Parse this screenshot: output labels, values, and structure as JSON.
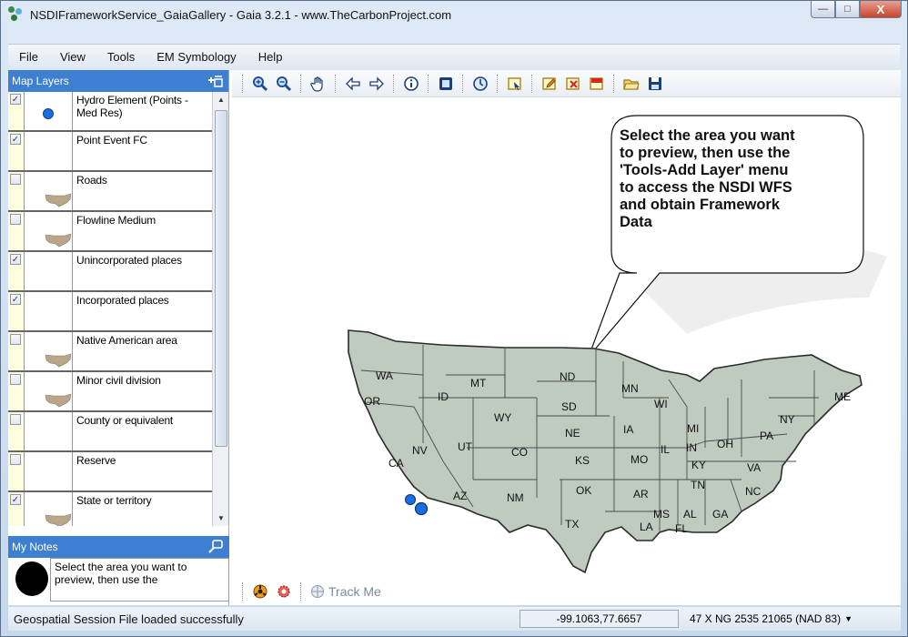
{
  "window": {
    "title": "NSDIFrameworkService_GaiaGallery - Gaia 3.2.1 - www.TheCarbonProject.com",
    "close_glyph": "X",
    "maximize_glyph": "□",
    "minimize_glyph": "—"
  },
  "menu": [
    "File",
    "View",
    "Tools",
    "EM Symbology",
    "Help"
  ],
  "map_layers": {
    "header": "Map Layers",
    "add_icon": "add-layer-icon",
    "items": [
      {
        "label": "Hydro Element (Points - Med Res)",
        "checked": true,
        "swatch": "dot"
      },
      {
        "label": "Point Event FC",
        "checked": true,
        "swatch": "none"
      },
      {
        "label": "Roads",
        "checked": false,
        "swatch": "map"
      },
      {
        "label": "Flowline Medium",
        "checked": false,
        "swatch": "map"
      },
      {
        "label": "Unincorporated places",
        "checked": true,
        "swatch": "none"
      },
      {
        "label": "Incorporated places",
        "checked": true,
        "swatch": "none"
      },
      {
        "label": "Native American area",
        "checked": false,
        "swatch": "map"
      },
      {
        "label": "Minor civil division",
        "checked": false,
        "swatch": "map"
      },
      {
        "label": "County or equivalent",
        "checked": false,
        "swatch": "none"
      },
      {
        "label": "Reserve",
        "checked": false,
        "swatch": "none"
      },
      {
        "label": "State or territory",
        "checked": true,
        "swatch": "map"
      }
    ]
  },
  "notes": {
    "header": "My Notes",
    "text": "Select the area you want to preview, then use the"
  },
  "callout": {
    "text": "Select the area you want\nto preview, then use the\n'Tools-Add Layer' menu\nto access the NSDI WFS\nand obtain Framework\nData"
  },
  "states": [
    "WA",
    "OR",
    "CA",
    "NV",
    "ID",
    "MT",
    "WY",
    "UT",
    "AZ",
    "CO",
    "NM",
    "ND",
    "SD",
    "NE",
    "KS",
    "OK",
    "TX",
    "MN",
    "IA",
    "MO",
    "AR",
    "LA",
    "WI",
    "IL",
    "MI",
    "IN",
    "OH",
    "KY",
    "TN",
    "MS",
    "AL",
    "GA",
    "FL",
    "NC",
    "VA",
    "PA",
    "NY",
    "ME"
  ],
  "bottom_toolbar": {
    "track_me": "Track Me"
  },
  "status": {
    "message": "Geospatial Session File loaded successfully",
    "coords": "-99.1063,77.6657",
    "grid": "47 X NG  2535 21065 (NAD 83)"
  },
  "colors": {
    "panel_header": "#3f7fd1",
    "map_fill": "#bfcbbf",
    "hydro_dot": "#1a6fe0"
  }
}
